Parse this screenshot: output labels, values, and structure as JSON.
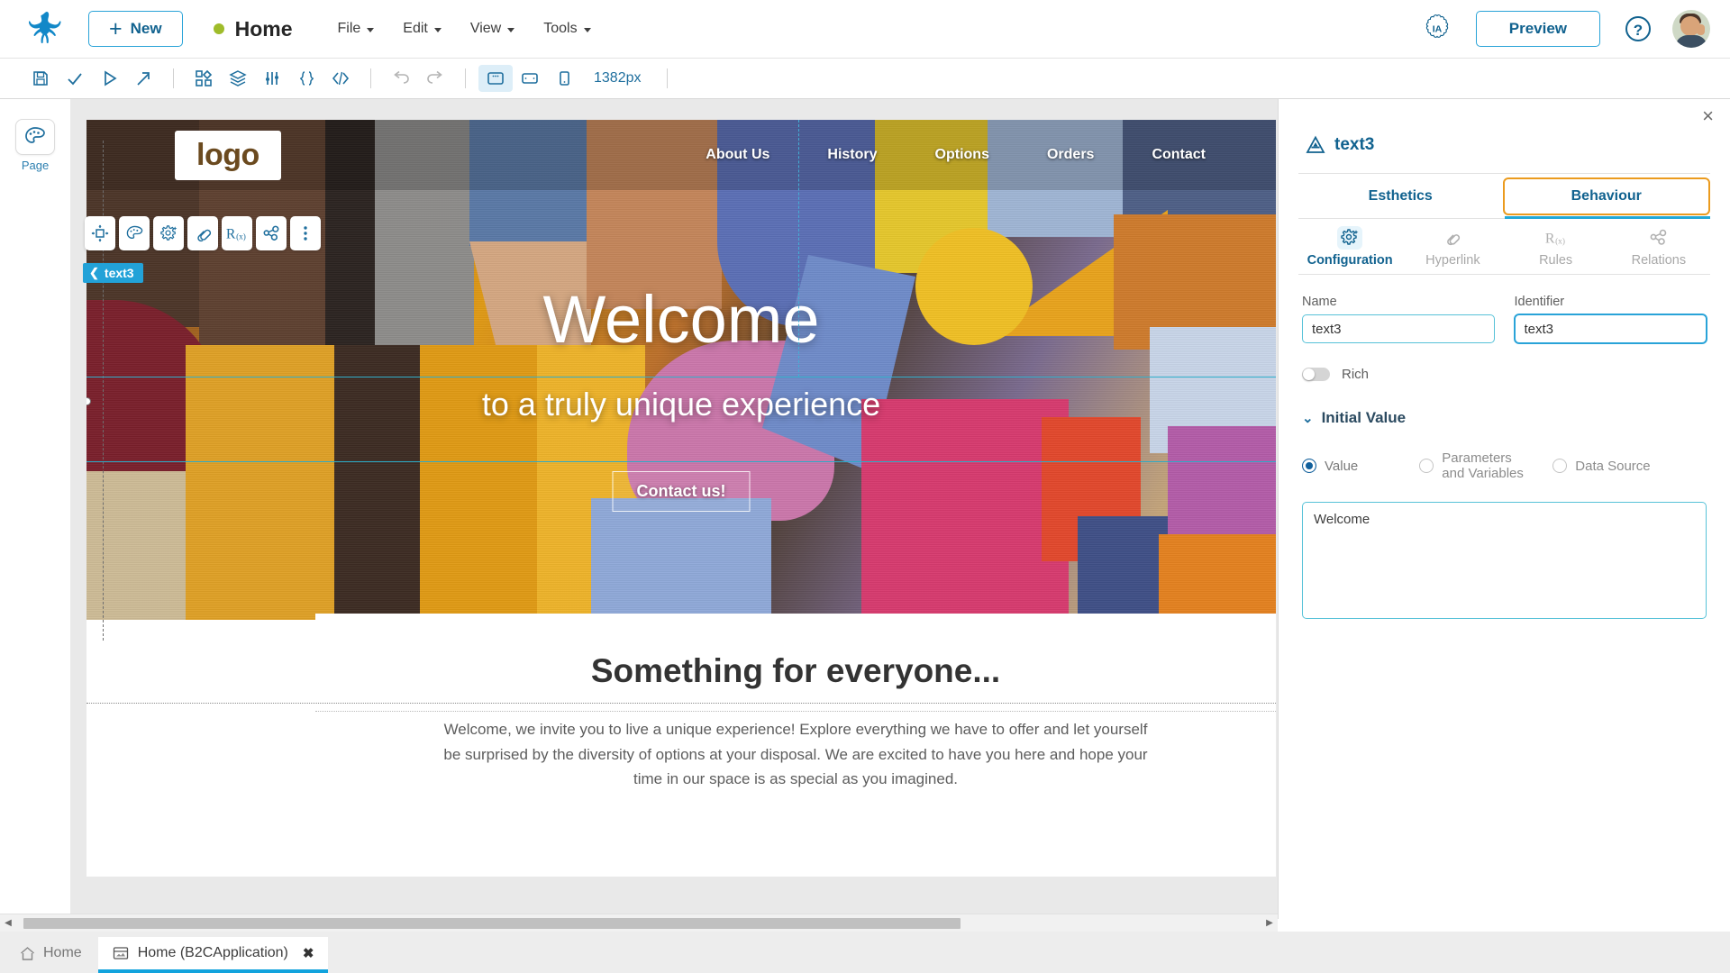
{
  "app": {
    "brand_icon": "frog-logo-icon",
    "accent_blue": "#11628f",
    "accent_cyan": "#22a8d8",
    "accent_orange": "#eb9b1e"
  },
  "topbar": {
    "new_label": "New",
    "new_plus": "+",
    "page_title": "Home",
    "status_dot_color": "#9fbc2a",
    "menus": [
      {
        "label": "File"
      },
      {
        "label": "Edit"
      },
      {
        "label": "View"
      },
      {
        "label": "Tools"
      }
    ],
    "ia_badge_label": "IA",
    "preview_label": "Preview",
    "help_label": "?"
  },
  "icontoolbar": {
    "items": [
      {
        "name": "save-icon",
        "state": "enabled"
      },
      {
        "name": "check-icon",
        "state": "enabled"
      },
      {
        "name": "run-icon",
        "state": "enabled"
      },
      {
        "name": "deploy-icon",
        "state": "enabled"
      },
      {
        "name": "components-icon",
        "state": "enabled"
      },
      {
        "name": "layers-icon",
        "state": "enabled"
      },
      {
        "name": "variables-icon",
        "state": "enabled"
      },
      {
        "name": "braces-icon",
        "state": "enabled"
      },
      {
        "name": "code-icon",
        "state": "enabled"
      },
      {
        "name": "undo-icon",
        "state": "disabled"
      },
      {
        "name": "redo-icon",
        "state": "disabled"
      },
      {
        "name": "desktop-view-icon",
        "state": "active"
      },
      {
        "name": "tablet-view-icon",
        "state": "enabled"
      },
      {
        "name": "mobile-view-icon",
        "state": "enabled"
      }
    ],
    "zoom_label": "1382px"
  },
  "leftrail": {
    "buttons": [
      {
        "icon": "palette-icon",
        "label": "Page"
      }
    ]
  },
  "canvas": {
    "selected_element_badge": "text3",
    "float_toolbar": [
      {
        "name": "move-icon"
      },
      {
        "name": "palette-icon"
      },
      {
        "name": "configuration-icon"
      },
      {
        "name": "hyperlink-icon"
      },
      {
        "name": "rules-icon"
      },
      {
        "name": "relations-icon"
      },
      {
        "name": "more-options-icon"
      }
    ],
    "site": {
      "logo_text": "logo",
      "nav_links": [
        "About Us",
        "History",
        "Options",
        "Orders",
        "Contact"
      ],
      "hero_title": "Welcome",
      "hero_subtitle": "to a truly unique experience",
      "hero_cta": "Contact us!",
      "section_title": "Something for everyone...",
      "section_body": "Welcome, we invite you to live a unique experience! Explore everything we have to offer and let yourself be surprised by the diversity of options at your disposal. We are excited to have you here and hope your time in our space is as special as you imagined."
    }
  },
  "rightpanel": {
    "close_label": "×",
    "element_icon": "text-element-icon",
    "element_name": "text3",
    "tabs": [
      {
        "label": "Esthetics",
        "selected": false,
        "focused": false
      },
      {
        "label": "Behaviour",
        "selected": true,
        "focused": true
      }
    ],
    "subtabs": [
      {
        "label": "Configuration",
        "icon": "configuration-icon",
        "selected": true
      },
      {
        "label": "Hyperlink",
        "icon": "hyperlink-icon",
        "selected": false
      },
      {
        "label": "Rules",
        "icon": "rules-icon",
        "selected": false
      },
      {
        "label": "Relations",
        "icon": "relations-icon",
        "selected": false
      }
    ],
    "fields": {
      "name_label": "Name",
      "name_value": "text3",
      "name_placeholder": "Name",
      "identifier_label": "Identifier",
      "identifier_value": "text3",
      "identifier_placeholder": "Identifier"
    },
    "rich_toggle": {
      "label": "Rich",
      "on": false
    },
    "initial_value": {
      "section_label": "Initial Value",
      "chevron": "⌄",
      "options": [
        {
          "label": "Value",
          "selected": true
        },
        {
          "label": "Parameters and Variables",
          "selected": false
        },
        {
          "label": "Data Source",
          "selected": false
        }
      ],
      "textarea_value": "Welcome",
      "textarea_placeholder": ""
    }
  },
  "bottombar": {
    "home_label": "Home",
    "home_icon": "home-icon",
    "tabs": [
      {
        "label": "Home (B2CApplication)",
        "icon": "page-icon",
        "close": "✖",
        "active": true
      }
    ]
  },
  "scrollbar": {
    "left_arrow": "◀",
    "right_arrow": "▶"
  }
}
